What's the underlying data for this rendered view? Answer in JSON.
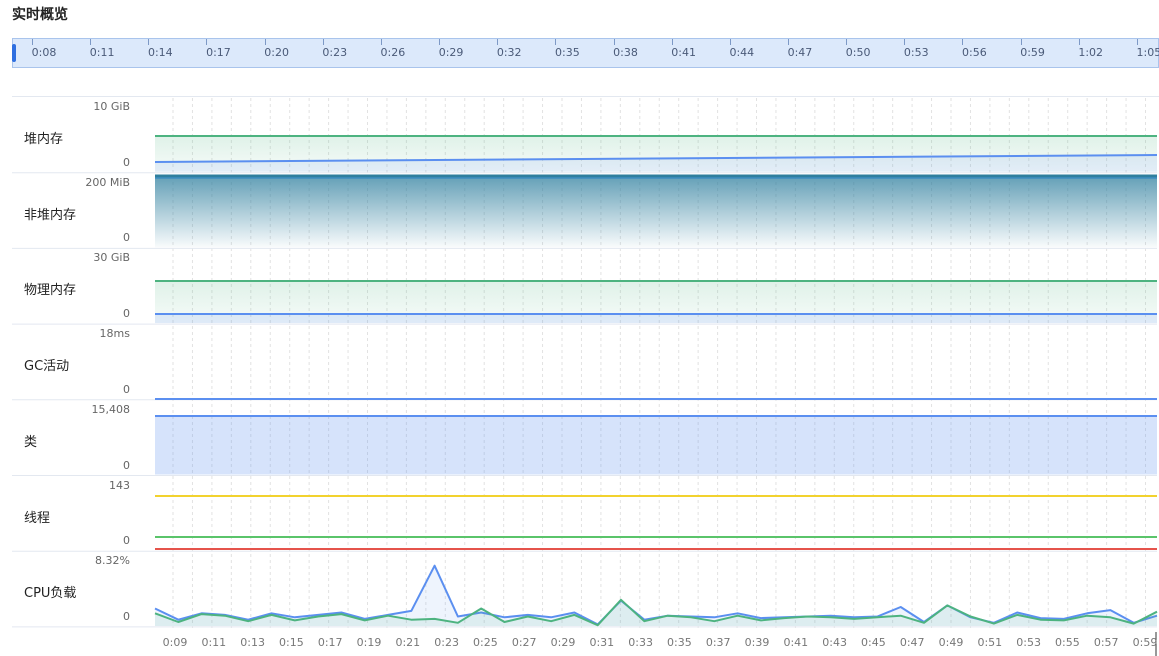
{
  "page": {
    "title": "实时概览"
  },
  "timeline": {
    "ticks": [
      "0:08",
      "0:11",
      "0:14",
      "0:17",
      "0:20",
      "0:23",
      "0:26",
      "0:29",
      "0:32",
      "0:35",
      "0:38",
      "0:41",
      "0:44",
      "0:47",
      "0:50",
      "0:53",
      "0:56",
      "0:59",
      "1:02",
      "1:05"
    ]
  },
  "rows": [
    {
      "label": "堆内存",
      "max": "10 GiB",
      "min": "0"
    },
    {
      "label": "非堆内存",
      "max": "200 MiB",
      "min": "0"
    },
    {
      "label": "物理内存",
      "max": "30 GiB",
      "min": "0"
    },
    {
      "label": "GC活动",
      "max": "18ms",
      "min": "0"
    },
    {
      "label": "类",
      "max": "15,408",
      "min": "0"
    },
    {
      "label": "线程",
      "max": "143",
      "min": "0"
    },
    {
      "label": "CPU负载",
      "max": "8.32%",
      "min": "0"
    }
  ],
  "xaxis": {
    "ticks": [
      "0:09",
      "0:11",
      "0:13",
      "0:15",
      "0:17",
      "0:19",
      "0:21",
      "0:23",
      "0:25",
      "0:27",
      "0:29",
      "0:31",
      "0:33",
      "0:35",
      "0:37",
      "0:39",
      "0:41",
      "0:43",
      "0:45",
      "0:47",
      "0:49",
      "0:51",
      "0:53",
      "0:55",
      "0:57",
      "0:59"
    ]
  },
  "colors": {
    "green": "#4db380",
    "blue": "#5b8ff0",
    "teal": "#2f7f9e",
    "yellow": "#f2d22e",
    "red": "#e5534b",
    "grid": "#e2e2e2"
  },
  "chart_data": {
    "type": "line",
    "series": [
      {
        "panel": "CPU负载",
        "values": [
          2.2,
          0.8,
          1.6,
          1.4,
          0.8,
          1.6,
          1.1,
          1.4,
          1.7,
          0.9,
          1.4,
          1.9,
          7.6,
          1.2,
          1.7,
          1.1,
          1.4,
          1.1,
          1.7,
          0.2,
          3.2,
          0.8,
          1.3,
          1.2,
          1.1,
          1.6,
          1.0,
          1.1,
          1.2,
          1.3,
          1.1,
          1.2,
          2.4,
          0.5,
          2.6,
          1.1,
          0.4,
          1.7,
          1.0,
          0.9,
          1.6,
          2.0,
          0.4,
          1.3
        ]
      },
      {
        "panel": "CPU负载",
        "values": [
          1.6,
          0.5,
          1.5,
          1.3,
          0.6,
          1.4,
          0.7,
          1.2,
          1.5,
          0.7,
          1.3,
          0.8,
          0.9,
          0.4,
          2.2,
          0.5,
          1.2,
          0.6,
          1.4,
          0.1,
          3.3,
          0.6,
          1.3,
          1.1,
          0.6,
          1.3,
          0.7,
          1.0,
          1.2,
          1.1,
          0.9,
          1.1,
          1.3,
          0.4,
          2.6,
          1.2,
          0.3,
          1.4,
          0.8,
          0.7,
          1.3,
          1.1,
          0.3,
          1.8
        ]
      }
    ]
  }
}
